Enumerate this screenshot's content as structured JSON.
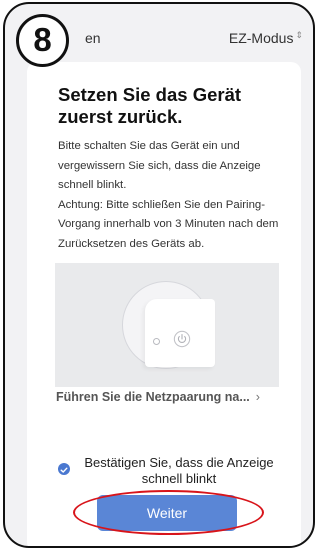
{
  "step_number": "8",
  "top_bar": {
    "cancel_label": "en",
    "mode_label": "EZ-Modus",
    "mode_chevron_icon": "chevron-updown-icon"
  },
  "content": {
    "title": "Setzen Sie das Gerät zuerst zurück.",
    "paragraph_1": "Bitte schalten Sie das Gerät ein und vergewissern Sie sich, dass die Anzeige schnell blinkt.",
    "paragraph_2": "Achtung: Bitte schließen Sie den Pairing-Vorgang innerhalb von 3 Minuten nach dem Zurücksetzen des Geräts ab.",
    "illustration_icon": "power-icon",
    "pairing_link": "Führen Sie die Netzpaarung na...",
    "pairing_arrow": "›",
    "confirm_text": "Bestätigen Sie, dass die Anzeige schnell blinkt",
    "confirm_checked": true,
    "button_label": "Weiter"
  },
  "colors": {
    "accent": "#5a86d6",
    "check": "#4a78d0",
    "callout": "#d8141a",
    "screen_bg": "#f2f2f4"
  }
}
